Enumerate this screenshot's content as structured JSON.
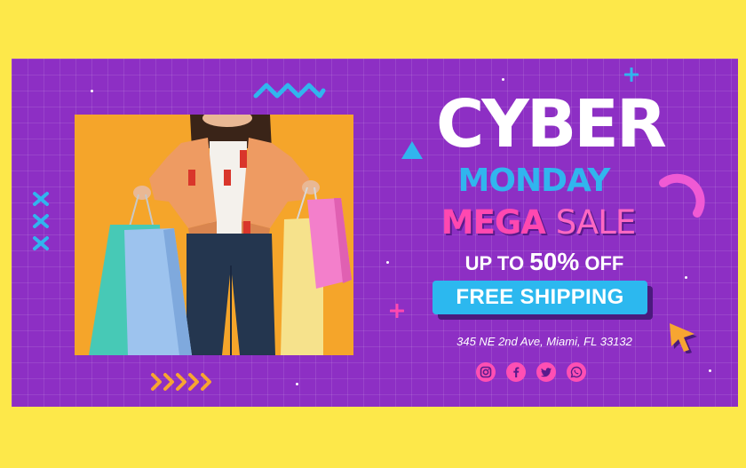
{
  "headline": "CYBER",
  "subheadline": "MONDAY",
  "sale": {
    "word1": "MEGA",
    "word2": "SALE"
  },
  "offer": {
    "prefix": "UP TO",
    "percent": "50%",
    "suffix": "OFF"
  },
  "shipping_button": "FREE SHIPPING",
  "address": "345 NE 2nd Ave, Miami, FL 33132",
  "social_icons": [
    "instagram-icon",
    "facebook-icon",
    "twitter-icon",
    "whatsapp-icon"
  ],
  "colors": {
    "page_background": "#fde84a",
    "banner_background": "#8d2fc4",
    "accent_blue": "#31b5ee",
    "accent_pink": "#ff48b0",
    "photo_background": "#f5a52a"
  }
}
